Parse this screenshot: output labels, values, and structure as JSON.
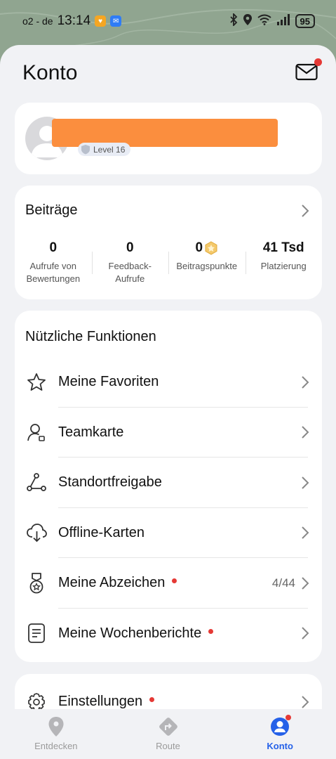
{
  "status_bar": {
    "carrier": "o2 - de",
    "time": "13:14",
    "battery": "95"
  },
  "header": {
    "title": "Konto"
  },
  "profile": {
    "level": "Level 16"
  },
  "contributions": {
    "title": "Beiträge",
    "stats": [
      {
        "value": "0",
        "label": "Aufrufe von Bewertungen"
      },
      {
        "value": "0",
        "label": "Feedback-Aufrufe"
      },
      {
        "value": "0",
        "label": "Beitragspunkte"
      },
      {
        "value": "41 Tsd",
        "label": "Platzierung"
      }
    ]
  },
  "functions": {
    "title": "Nützliche Funktionen",
    "items": [
      {
        "label": "Meine Favoriten",
        "icon": "star-icon"
      },
      {
        "label": "Teamkarte",
        "icon": "team-map-icon"
      },
      {
        "label": "Standortfreigabe",
        "icon": "location-share-icon"
      },
      {
        "label": "Offline-Karten",
        "icon": "cloud-download-icon"
      },
      {
        "label": "Meine Abzeichen",
        "icon": "medal-icon",
        "count": "4/44",
        "dot": true
      },
      {
        "label": "Meine Wochenberichte",
        "icon": "report-icon",
        "dot": true
      }
    ]
  },
  "settings": {
    "label": "Einstellungen"
  },
  "bottom_nav": {
    "items": [
      {
        "label": "Entdecken",
        "icon": "location-pin-icon"
      },
      {
        "label": "Route",
        "icon": "route-icon"
      },
      {
        "label": "Konto",
        "icon": "account-icon",
        "active": true
      }
    ]
  },
  "colors": {
    "accent": "#2561e8",
    "notification": "#e53935",
    "redaction": "#fb8e3e"
  }
}
